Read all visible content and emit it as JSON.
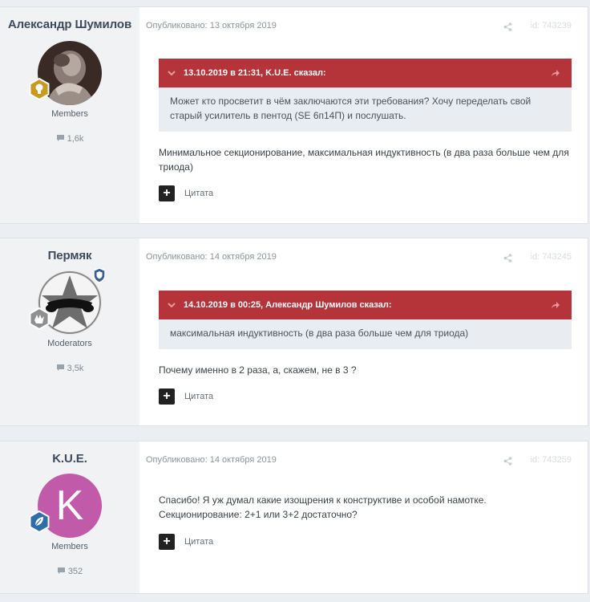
{
  "posts": [
    {
      "author": "Александр Шумилов",
      "group": "Members",
      "count": "1,6k",
      "published": "Опубликовано: 13 октября 2019",
      "id": "id: 743239",
      "quote": {
        "header": "13.10.2019 в 21:31, K.U.E. сказал:",
        "text": "Может кто просветит в чём заключаются эти требования? Хочу переделать свой старый усилитель в пентод (SE 6п14П) и послушать."
      },
      "text": "Минимальное секционирование, максимальная индуктивность (в два раза больше чем для триода)",
      "quote_label": "Цитата",
      "plus_label": "+"
    },
    {
      "author": "Пермяк",
      "group": "Moderators",
      "count": "3,5k",
      "published": "Опубликовано: 14 октября 2019",
      "id": "id: 743245",
      "quote": {
        "header": "14.10.2019 в 00:25, Александр Шумилов сказал:",
        "text": "максимальная индуктивность (в два раза больше чем для триода)"
      },
      "text": "Почему именно в 2 раза, а, скажем, не в 3 ?",
      "quote_label": "Цитата",
      "plus_label": "+"
    },
    {
      "author": "K.U.E.",
      "group": "Members",
      "count": "352",
      "published": "Опубликовано: 14 октября 2019",
      "id": "id: 743259",
      "avatar_letter": "K",
      "text_line1": "Спасибо! Я уж думал какие изощрения к конструктиве и особой намотке.",
      "text_line2": "Секционирование: 2+1 или 3+2 достаточно?",
      "quote_label": "Цитата",
      "plus_label": "+"
    }
  ],
  "colors": {
    "quote_header": "#b5343a",
    "avatar_kue": "#c25aaa",
    "badge_gold": "#c89a1e",
    "badge_blue": "#2f6ea8"
  }
}
